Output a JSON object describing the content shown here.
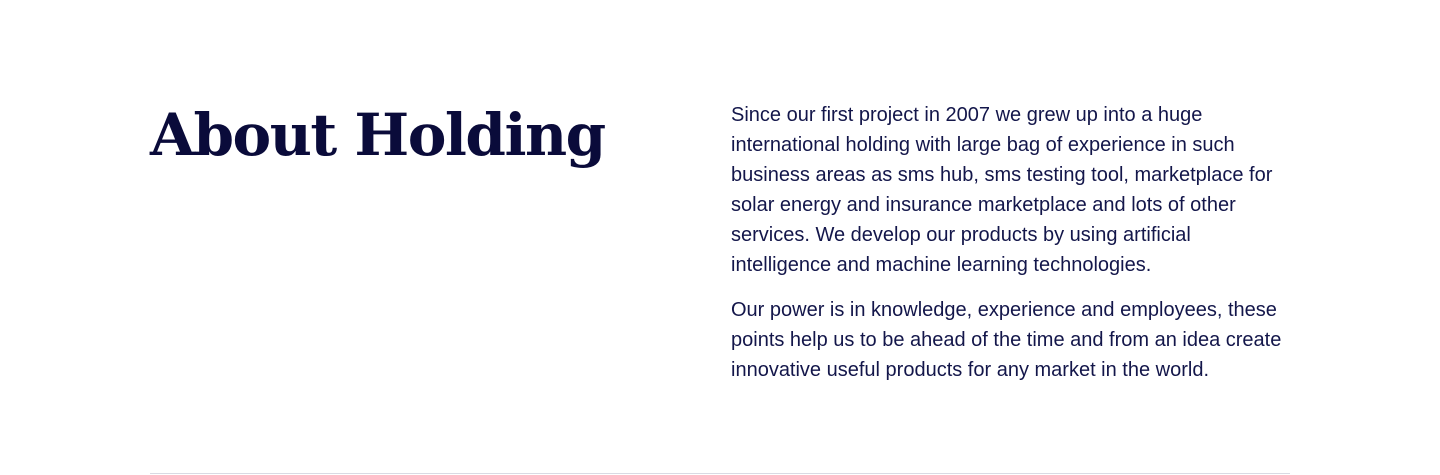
{
  "about": {
    "title": "About Holding",
    "paragraphs": [
      "Since our first project in 2007 we grew up into a huge international holding with large bag of experience in such business areas as sms hub, sms testing tool, marketplace for solar energy and insurance marketplace and lots of other services. We develop our products by using artificial intelligence and machine learning technologies.",
      "Our power is in knowledge, experience and employees, these points help us to be ahead of the time and from an idea create innovative useful products for any market in the world."
    ]
  },
  "colors": {
    "heading": "#0a0b3a",
    "text": "#13164a",
    "background": "#ffffff",
    "divider": "#d9dae3"
  }
}
